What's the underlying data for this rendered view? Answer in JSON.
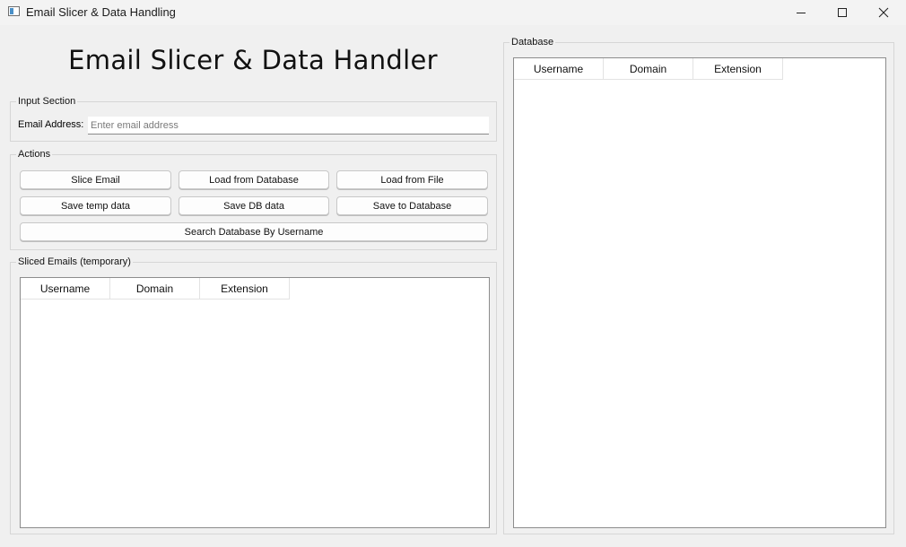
{
  "window": {
    "title": "Email Slicer & Data Handling",
    "controls": [
      "minimize",
      "maximize",
      "close"
    ]
  },
  "heading": "Email Slicer & Data Handler",
  "input_section": {
    "title": "Input Section",
    "email_label": "Email Address:",
    "email_value": "",
    "email_placeholder": "Enter email address"
  },
  "actions": {
    "title": "Actions",
    "slice_email": "Slice Email",
    "load_from_database": "Load from Database",
    "load_from_file": "Load from File",
    "save_temp_data": "Save temp data",
    "save_db_data": "Save DB data",
    "save_to_database": "Save to Database",
    "search_by_username": "Search Database By Username"
  },
  "sliced_emails": {
    "title": "Sliced Emails (temporary)",
    "columns": [
      "Username",
      "Domain",
      "Extension"
    ],
    "rows": []
  },
  "database": {
    "title": "Database",
    "columns": [
      "Username",
      "Domain",
      "Extension"
    ],
    "rows": []
  }
}
